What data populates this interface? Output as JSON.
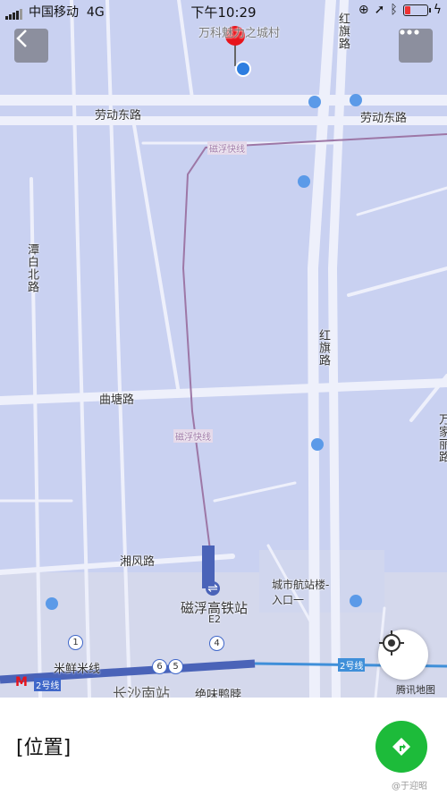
{
  "status_bar": {
    "carrier": "中国移动",
    "network": "4G",
    "time": "下午10:29",
    "battery_level": 0.25
  },
  "map": {
    "road_labels": {
      "laodong_left": "劳动东路",
      "laodong_right": "劳动东路",
      "tan_bai_bei": "潭白北路",
      "hongqi_top": "红旗路",
      "hongqi_mid": "红旗路",
      "qutang": "曲塘路",
      "xiangfeng": "湘风路",
      "right_edge": "万家丽路"
    },
    "poi_labels": {
      "vanke_village": "万科魅力之城村",
      "maglev_line_top": "磁浮快线",
      "maglev_line_mid": "磁浮快线",
      "maglev_station": "磁浮高铁站",
      "exit_e2": "E2",
      "terminal_entrance": "城市航站楼-入口一",
      "rice_noodle": "米鲜米线",
      "station_name": "长沙南站",
      "juewei": "绝味鸭脖",
      "line2_left": "2号线",
      "line2_right": "2号线"
    },
    "exit_badges": [
      "1",
      "4",
      "6",
      "5"
    ],
    "provider_logo": "腾讯地图",
    "colors": {
      "land": "#c9d1f1",
      "road": "#eef0fb",
      "maglev": "#9d77a6",
      "metro": "#3f67c9",
      "pin": "#e8141c"
    }
  },
  "ui": {
    "back_icon": "back-arrow-icon",
    "more_icon": "more-dots-icon",
    "locate_icon": "locate-crosshair-icon",
    "nav_icon": "navigation-arrow-icon"
  },
  "bottom_panel": {
    "title": "[位置]"
  },
  "watermark": "@于迎昭"
}
